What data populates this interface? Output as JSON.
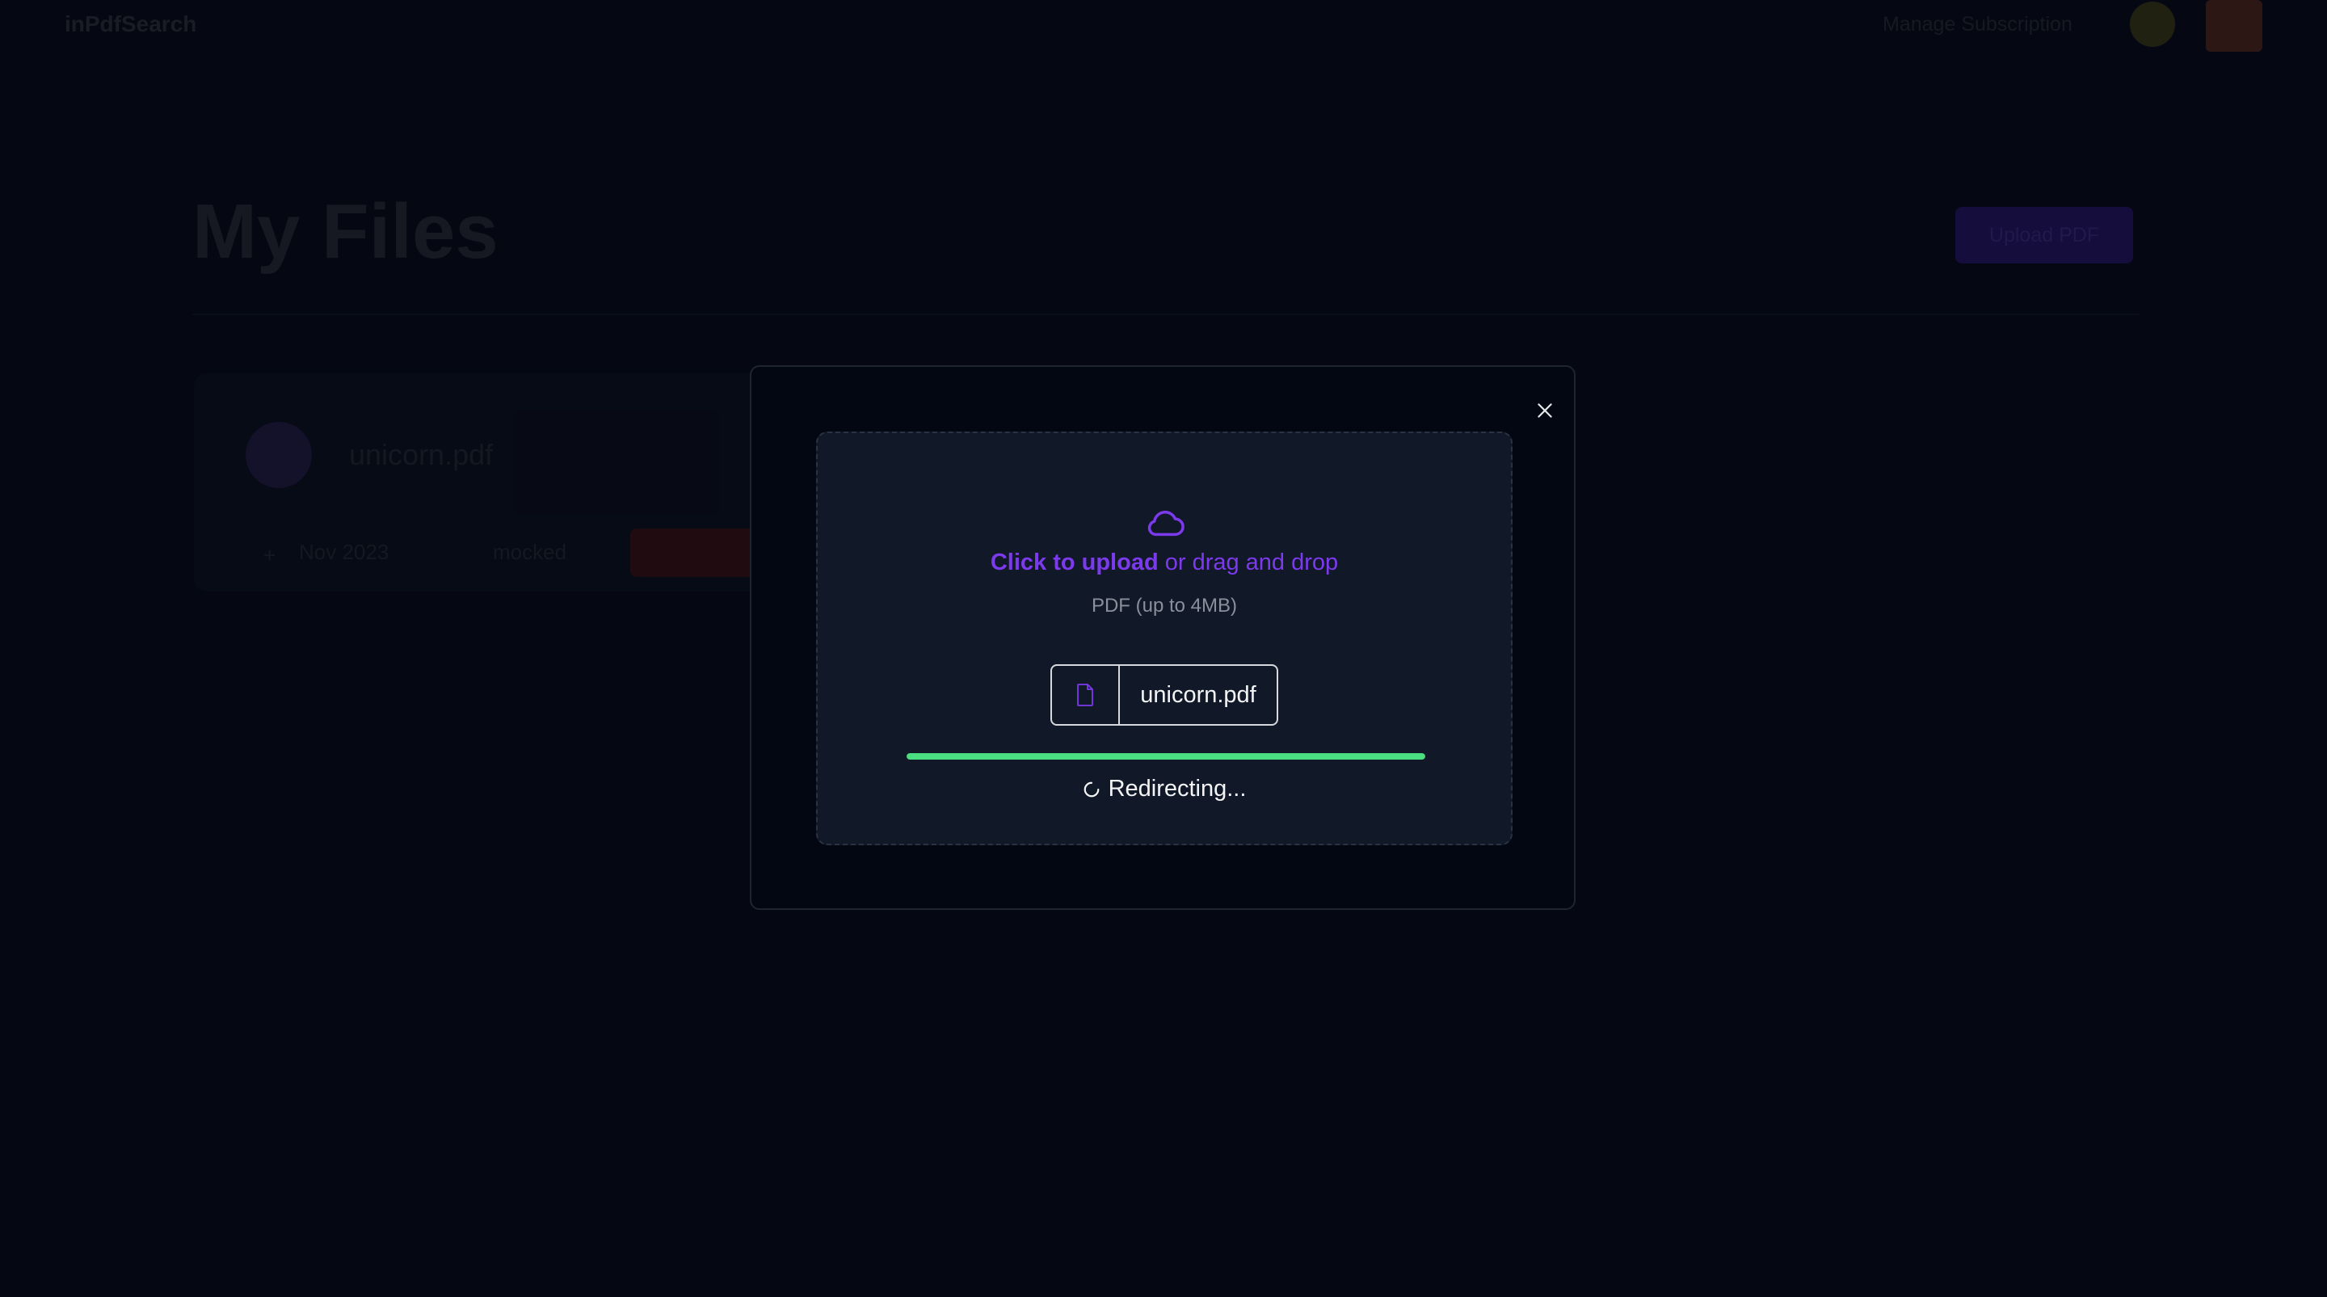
{
  "header": {
    "brand": "inPdfSearch",
    "nav_link": "Manage Subscription"
  },
  "page": {
    "title": "My Files",
    "upload_button": "Upload PDF"
  },
  "file_card": {
    "name": "unicorn.pdf",
    "meta": "Nov 2023",
    "messages": "mocked"
  },
  "modal": {
    "upload_strong": "Click to upload",
    "upload_rest": " or drag and drop",
    "hint": "PDF (up to 4MB)",
    "file_name": "unicorn.pdf",
    "progress_percent": 100,
    "status": "Redirecting...",
    "colors": {
      "accent": "#7c3aed",
      "progress": "#4ade80",
      "dropzone_bg": "#111827"
    },
    "icons": [
      "close-icon",
      "cloud-icon",
      "file-icon",
      "spinner-icon"
    ]
  }
}
